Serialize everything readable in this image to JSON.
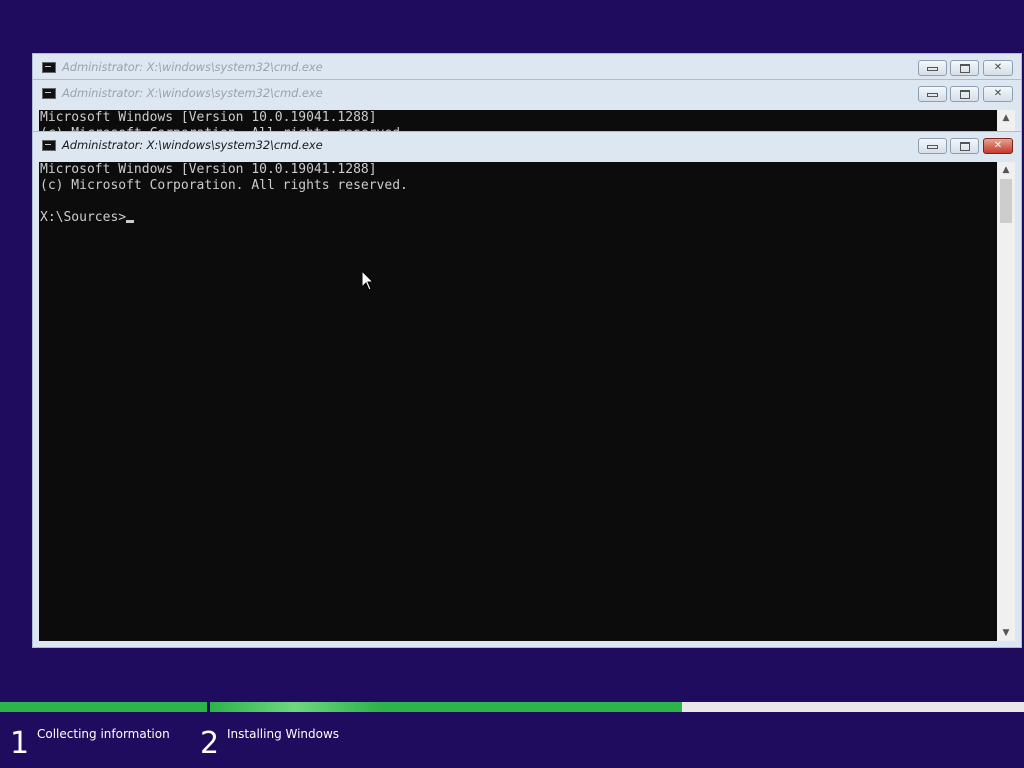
{
  "windows": [
    {
      "title": "Administrator: X:\\windows\\system32\\cmd.exe"
    },
    {
      "title": "Administrator: X:\\windows\\system32\\cmd.exe",
      "lines": [
        "Microsoft Windows [Version 10.0.19041.1288]",
        "(c) Microsoft Corporation. All rights reserved."
      ]
    },
    {
      "title": "Administrator: X:\\windows\\system32\\cmd.exe",
      "lines": [
        "Microsoft Windows [Version 10.0.19041.1288]",
        "(c) Microsoft Corporation. All rights reserved.",
        "",
        "X:\\Sources>"
      ]
    }
  ],
  "setup": {
    "steps": [
      {
        "number": "1",
        "label": "Collecting information",
        "progress": 1.0
      },
      {
        "number": "2",
        "label": "Installing Windows",
        "progress": 0.58
      }
    ]
  },
  "colors": {
    "background": "#1f0c5e",
    "progress_fill": "#2db34a",
    "progress_track": "#e8e8e8",
    "console_bg": "#0c0c0c",
    "console_text": "#cccccc"
  }
}
